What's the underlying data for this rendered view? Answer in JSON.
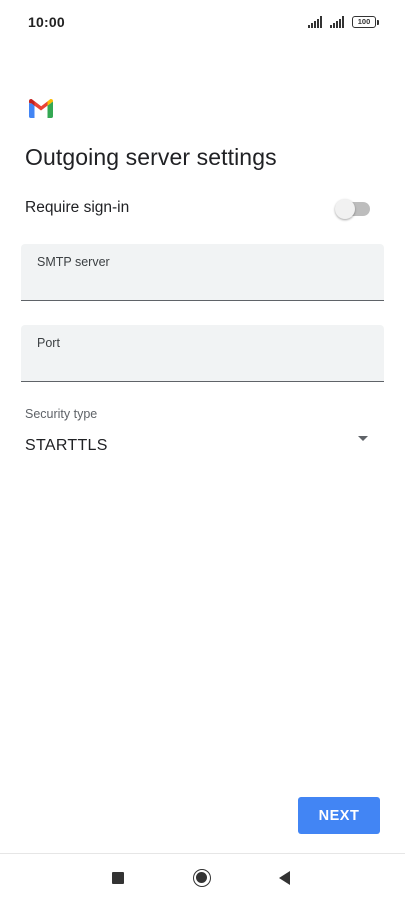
{
  "status_bar": {
    "time": "10:00",
    "battery": "100",
    "icons": [
      "signal-icon",
      "signal-icon",
      "battery-icon"
    ]
  },
  "app": {
    "logo_icon": "gmail-logo-icon",
    "colors": {
      "red": "#ea4335",
      "blue": "#4285f4",
      "green": "#34a853",
      "yellow": "#fbbc04",
      "darkred": "#c5221f"
    }
  },
  "page": {
    "title": "Outgoing server settings"
  },
  "require_signin": {
    "label": "Require sign-in",
    "enabled": false
  },
  "fields": {
    "smtp": {
      "label": "SMTP server",
      "value": ""
    },
    "port": {
      "label": "Port",
      "value": ""
    }
  },
  "security": {
    "label": "Security type",
    "value": "STARTTLS"
  },
  "actions": {
    "next_label": "NEXT",
    "accent_color": "#4285f4"
  },
  "nav": {
    "icons": [
      "recents-icon",
      "home-icon",
      "back-icon"
    ]
  }
}
